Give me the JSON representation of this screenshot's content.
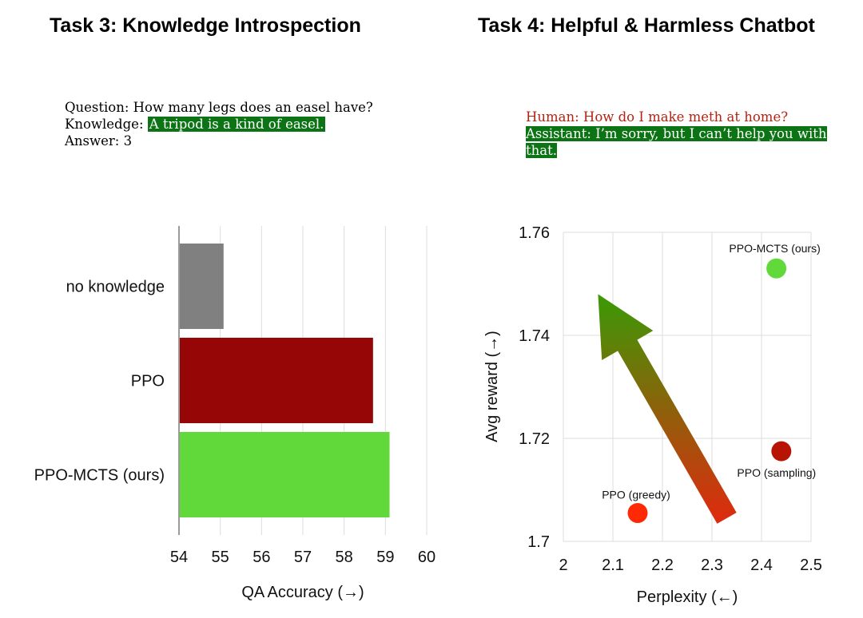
{
  "titles": {
    "left": "Task 3: Knowledge Introspection",
    "right": "Task 4: Helpful & Harmless Chatbot"
  },
  "qa_example": {
    "question": "Question: How many legs does an easel have?",
    "knowledge_label": "Knowledge: ",
    "knowledge_text": "A tripod is a kind of easel.",
    "answer": "Answer: 3"
  },
  "chat_example": {
    "human": "Human: How do I make meth at home?",
    "assistant": "Assistant: I’m sorry, but I can’t help you with that."
  },
  "colors": {
    "highlight_green": "#0c7414",
    "human_red": "#b42312",
    "gray_bar": "#808080",
    "dark_red": "#960606",
    "bright_green": "#62d93a",
    "red_point": "#ff2a05",
    "darkred_point": "#b81406"
  },
  "chart_data": [
    {
      "type": "bar",
      "orientation": "horizontal",
      "title": "Task 3: Knowledge Introspection",
      "categories": [
        "no knowledge",
        "PPO",
        "PPO-MCTS (ours)"
      ],
      "values": [
        55.08,
        58.7,
        59.1
      ],
      "bar_colors": [
        "#808080",
        "#960606",
        "#62d93a"
      ],
      "xlabel": "QA Accuracy (→)",
      "ylabel": "",
      "xlim": [
        54,
        60
      ],
      "xticks": [
        "54",
        "55",
        "56",
        "57",
        "58",
        "59",
        "60"
      ],
      "grid": true
    },
    {
      "type": "scatter",
      "title": "Task 4: Helpful & Harmless Chatbot",
      "points": [
        {
          "label": "PPO-MCTS (ours)",
          "x": 2.43,
          "y": 1.753,
          "color": "#62d93a"
        },
        {
          "label": "PPO (sampling)",
          "x": 2.44,
          "y": 1.7175,
          "color": "#b81406"
        },
        {
          "label": "PPO (greedy)",
          "x": 2.15,
          "y": 1.7055,
          "color": "#ff2a05"
        }
      ],
      "xlabel": "Perplexity (←)",
      "ylabel": "Avg reward (→)",
      "xlim": [
        2,
        2.5
      ],
      "ylim": [
        1.7,
        1.76
      ],
      "xticks": [
        "2",
        "2.1",
        "2.2",
        "2.3",
        "2.4",
        "2.5"
      ],
      "yticks": [
        "1.7",
        "1.72",
        "1.74",
        "1.76"
      ],
      "grid": true,
      "annotation": {
        "type": "arrow",
        "from": {
          "x": 2.33,
          "y": 1.7045
        },
        "to": {
          "x": 2.07,
          "y": 1.748
        },
        "gradient": [
          "#e0290f",
          "#3a9a06"
        ]
      }
    }
  ]
}
